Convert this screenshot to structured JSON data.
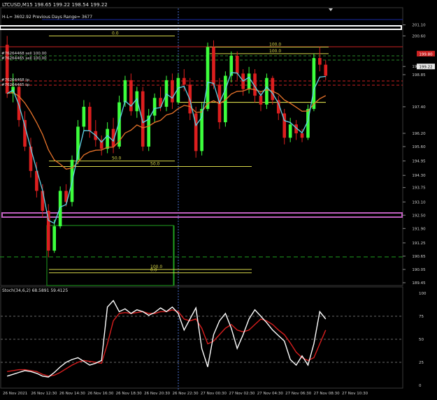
{
  "header": {
    "symbol_line": "LTCUSD,M15  198.65 199.22 198.54 199.22",
    "info_line": "H-L= 3602.92  Previous Days Range= 3677",
    "order1": "#76264468 sell 100.00",
    "order2": "#76264465 sell 100.00",
    "tp1": "#76264468 tp",
    "tp2": "#76264465 tp"
  },
  "colors": {
    "background": "#000000",
    "bull": "#3cff3c",
    "bear": "#dc1e1e",
    "ma_fast": "#5fd3e8",
    "ma_slow": "#e8732a",
    "stoch_main": "#ffffff",
    "stoch_signal": "#d81e1e",
    "fib_yellow": "#d8d84a",
    "box_magenta": "#c060c0",
    "green_box": "#1fa01f"
  },
  "chart_data": [
    {
      "type": "candlestick",
      "symbol": "LTCUSD",
      "timeframe": "M15",
      "ylim": [
        189.45,
        201.75
      ],
      "price_ticks": [
        "201.10",
        "200.60",
        "199.22",
        "198.85",
        "197.40",
        "196.20",
        "195.60",
        "194.95",
        "194.30",
        "193.75",
        "193.10",
        "192.50",
        "191.90",
        "191.25",
        "190.65",
        "190.05",
        "189.45"
      ],
      "current_price": "199.22",
      "sell_order_level": "199.80",
      "time_labels": [
        "26 Nov 2021",
        "26 Nov 12:30",
        "26 Nov 14:30",
        "26 Nov 16:30",
        "26 Nov 18:30",
        "26 Nov 20:30",
        "26 Nov 22:30",
        "27 Nov 00:30",
        "27 Nov 02:30",
        "27 Nov 04:30",
        "27 Nov 06:30",
        "27 Nov 08:30",
        "27 Nov 10:30"
      ],
      "candles": [
        [
          200.2,
          200.6,
          197.8,
          198.0
        ],
        [
          198.0,
          198.9,
          197.6,
          198.3
        ],
        [
          198.3,
          198.4,
          196.5,
          196.8
        ],
        [
          196.8,
          197.2,
          195.4,
          195.6
        ],
        [
          195.6,
          196.0,
          194.2,
          194.5
        ],
        [
          194.5,
          194.9,
          193.3,
          193.6
        ],
        [
          193.6,
          193.9,
          192.4,
          192.7
        ],
        [
          192.7,
          193.0,
          190.6,
          190.9
        ],
        [
          190.9,
          192.3,
          190.8,
          192.0
        ],
        [
          192.0,
          193.8,
          191.9,
          193.6
        ],
        [
          193.6,
          193.9,
          192.9,
          193.1
        ],
        [
          193.1,
          195.2,
          192.9,
          195.0
        ],
        [
          195.0,
          196.8,
          194.8,
          196.5
        ],
        [
          196.5,
          197.7,
          196.3,
          197.4
        ],
        [
          197.4,
          197.6,
          196.0,
          196.3
        ],
        [
          196.3,
          196.8,
          195.6,
          195.9
        ],
        [
          195.9,
          196.1,
          195.2,
          195.5
        ],
        [
          195.5,
          196.7,
          195.3,
          196.4
        ],
        [
          196.4,
          196.9,
          195.3,
          195.6
        ],
        [
          195.6,
          197.9,
          195.5,
          197.6
        ],
        [
          197.6,
          198.8,
          197.4,
          198.6
        ],
        [
          198.6,
          198.9,
          197.0,
          197.2
        ],
        [
          197.2,
          198.3,
          196.9,
          198.1
        ],
        [
          198.1,
          198.3,
          195.4,
          195.6
        ],
        [
          195.6,
          197.3,
          195.4,
          197.0
        ],
        [
          197.0,
          198.0,
          196.7,
          197.8
        ],
        [
          197.8,
          198.3,
          197.2,
          197.4
        ],
        [
          197.4,
          198.8,
          197.2,
          198.6
        ],
        [
          198.6,
          198.9,
          197.3,
          197.6
        ],
        [
          197.6,
          198.9,
          197.5,
          198.7
        ],
        [
          198.7,
          199.1,
          198.1,
          198.4
        ],
        [
          198.4,
          198.7,
          196.8,
          197.1
        ],
        [
          197.1,
          197.4,
          195.1,
          195.4
        ],
        [
          195.4,
          197.6,
          195.2,
          197.3
        ],
        [
          197.3,
          200.3,
          197.2,
          200.1
        ],
        [
          200.1,
          200.4,
          198.2,
          198.4
        ],
        [
          198.4,
          198.7,
          196.4,
          196.7
        ],
        [
          196.7,
          199.0,
          196.5,
          198.8
        ],
        [
          198.8,
          199.9,
          198.5,
          199.7
        ],
        [
          199.7,
          199.9,
          198.6,
          198.9
        ],
        [
          198.9,
          199.1,
          197.9,
          198.2
        ],
        [
          198.2,
          199.2,
          198.0,
          198.9
        ],
        [
          198.9,
          199.1,
          197.6,
          197.9
        ],
        [
          197.9,
          198.1,
          197.2,
          197.5
        ],
        [
          197.5,
          198.9,
          197.3,
          198.7
        ],
        [
          198.7,
          198.8,
          197.5,
          197.7
        ],
        [
          197.7,
          197.9,
          196.8,
          197.1
        ],
        [
          197.1,
          197.3,
          195.7,
          196.0
        ],
        [
          196.0,
          196.9,
          195.8,
          196.6
        ],
        [
          196.6,
          196.8,
          195.9,
          196.2
        ],
        [
          196.2,
          196.4,
          195.8,
          196.0
        ],
        [
          196.0,
          197.5,
          195.9,
          197.3
        ],
        [
          197.3,
          199.8,
          197.2,
          199.6
        ],
        [
          199.6,
          200.1,
          199.0,
          199.3
        ],
        [
          199.3,
          199.5,
          198.6,
          198.8
        ]
      ],
      "fib_levels": [
        {
          "label": "0.0",
          "price": "200.6"
        },
        {
          "label": "100.0",
          "price": "199.8"
        },
        {
          "label": "100.0",
          "price": "200.1"
        },
        {
          "label": "50.0",
          "price": "194.95"
        },
        {
          "label": "50.0",
          "price": "194.7"
        },
        {
          "label": "100.0",
          "price": "190.05"
        },
        {
          "label": "0.0",
          "price": "189.9"
        }
      ]
    },
    {
      "type": "line",
      "title": "Stoch(34,6,2) 68.5891 59.4125",
      "ylim": [
        0,
        100
      ],
      "ticks": [
        "100",
        "75",
        "50",
        "25",
        "0"
      ],
      "series": [
        {
          "values": [
            10,
            12,
            14,
            16,
            15,
            13,
            10,
            9,
            14,
            20,
            25,
            28,
            30,
            26,
            22,
            24,
            27,
            85,
            92,
            80,
            83,
            78,
            82,
            80,
            76,
            79,
            84,
            80,
            85,
            78,
            60,
            72,
            84,
            40,
            20,
            55,
            70,
            78,
            62,
            40,
            55,
            72,
            82,
            75,
            68,
            60,
            54,
            48,
            28,
            22,
            32,
            22,
            45,
            80,
            72
          ]
        },
        {
          "values": [
            15,
            16,
            17,
            17,
            16,
            15,
            12,
            10,
            11,
            14,
            18,
            22,
            25,
            27,
            26,
            25,
            24,
            45,
            70,
            78,
            79,
            78,
            79,
            80,
            78,
            78,
            80,
            80,
            82,
            80,
            72,
            70,
            72,
            62,
            45,
            48,
            55,
            62,
            66,
            60,
            58,
            60,
            66,
            72,
            70,
            66,
            60,
            55,
            46,
            36,
            30,
            27,
            30,
            45,
            60
          ]
        }
      ]
    }
  ]
}
